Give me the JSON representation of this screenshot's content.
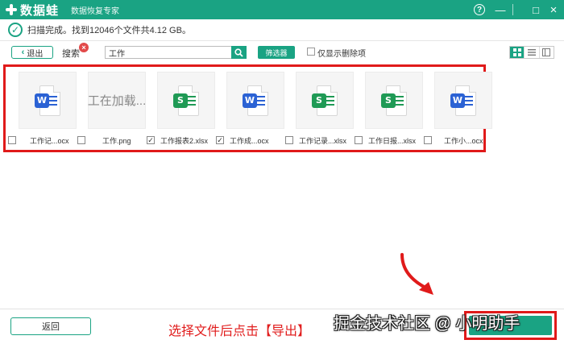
{
  "app": {
    "name": "数据蛙",
    "subtitle": "数据恢复专家",
    "brand_color": "#1aa383",
    "window_controls": {
      "help": "?",
      "minimize": "—",
      "maximize": "□",
      "close": "×"
    }
  },
  "status": {
    "text": "扫描完成。找到12046个文件共4.12 GB。"
  },
  "toolbar": {
    "back_label": "退出",
    "search_label": "搜索",
    "search_value": "工作",
    "filter_label": "筛选器",
    "deleted_only_label": "仅显示删除项",
    "view_modes": [
      "grid-icon",
      "list-icon",
      "detail-icon"
    ]
  },
  "files": [
    {
      "name": "工作记...ocx",
      "kind": "word",
      "checked": false,
      "check_mark": ""
    },
    {
      "name": "工作.png",
      "kind": "loading",
      "loading_text": "工在加载...",
      "checked": false,
      "check_mark": ""
    },
    {
      "name": "工作报表2.xlsx",
      "kind": "excel",
      "checked": true,
      "check_mark": "✓"
    },
    {
      "name": "工作成...ocx",
      "kind": "word",
      "checked": true,
      "check_mark": "✓"
    },
    {
      "name": "工作记录...xlsx",
      "kind": "excel",
      "checked": false,
      "check_mark": ""
    },
    {
      "name": "工作日报...xlsx",
      "kind": "excel",
      "checked": false,
      "check_mark": ""
    },
    {
      "name": "工作小...ocx",
      "kind": "word",
      "checked": false,
      "check_mark": ""
    }
  ],
  "footer": {
    "return_label": "返回",
    "instruction": "选择文件后点击【导出】",
    "watermark": "掘金技术社区 @ 小明助手"
  },
  "colors": {
    "word": "#2b62d4",
    "excel": "#1f9a55",
    "highlight": "#e01a1a"
  }
}
